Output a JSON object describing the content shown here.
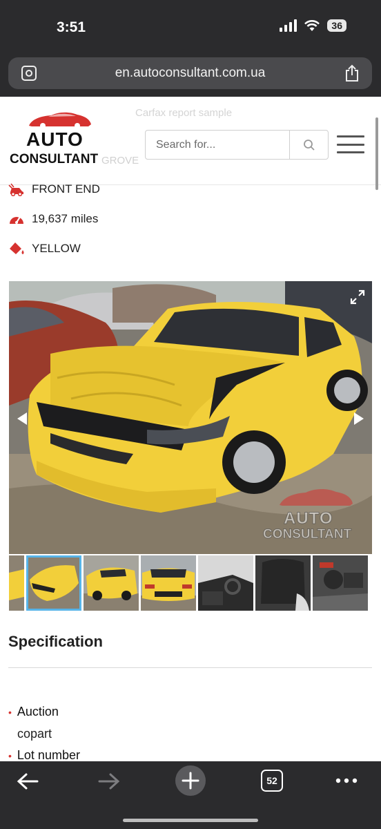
{
  "status": {
    "time": "3:51",
    "battery": "36"
  },
  "browser": {
    "url": "en.autoconsultant.com.ua",
    "tab_count": "52"
  },
  "header": {
    "logo_auto": "AUTO",
    "logo_consultant": "CONSULTANT",
    "ghost_heading": "Carfax report sample",
    "ghost_location": "GROVE",
    "search_placeholder": "Search for..."
  },
  "details": [
    {
      "icon": "car-damage-icon",
      "text": "FRONT END"
    },
    {
      "icon": "speedometer-icon",
      "text": "19,637 miles"
    },
    {
      "icon": "paint-bucket-icon",
      "text": "YELLOW"
    }
  ],
  "gallery": {
    "watermark_auto": "AUTO",
    "watermark_consultant": "CONSULTANT"
  },
  "specification": {
    "title": "Specification",
    "items": [
      {
        "label": "Auction",
        "value": "copart"
      },
      {
        "label": "Lot number",
        "value": ""
      }
    ]
  },
  "colors": {
    "brand_red": "#d6322f",
    "car_yellow": "#f2cf3a",
    "chrome_dark": "#2b2b2d"
  }
}
